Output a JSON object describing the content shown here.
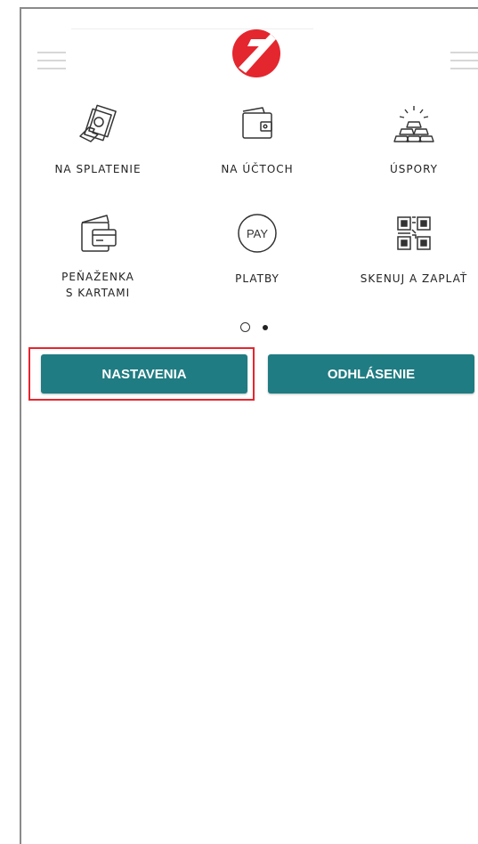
{
  "tiles": [
    {
      "label": "NA SPLATENIE",
      "icon": "hand-money-icon"
    },
    {
      "label": "NA ÚČTOCH",
      "icon": "wallet-icon"
    },
    {
      "label": "ÚSPORY",
      "icon": "gold-bars-icon"
    },
    {
      "label": "PEŇAŽENKA\nS KARTAMI",
      "icon": "cards-wallet-icon"
    },
    {
      "label": "PLATBY",
      "icon": "pay-icon",
      "icon_text": "PAY"
    },
    {
      "label": "SKENUJ A ZAPLAŤ",
      "icon": "qr-code-icon"
    }
  ],
  "pager": {
    "pages": 2,
    "active": 2
  },
  "buttons": {
    "settings": "NASTAVENIA",
    "logout": "ODHLÁSENIE"
  },
  "colors": {
    "accent": "#1f7c82",
    "brand": "#e4262f",
    "highlight": "#e4262f"
  }
}
